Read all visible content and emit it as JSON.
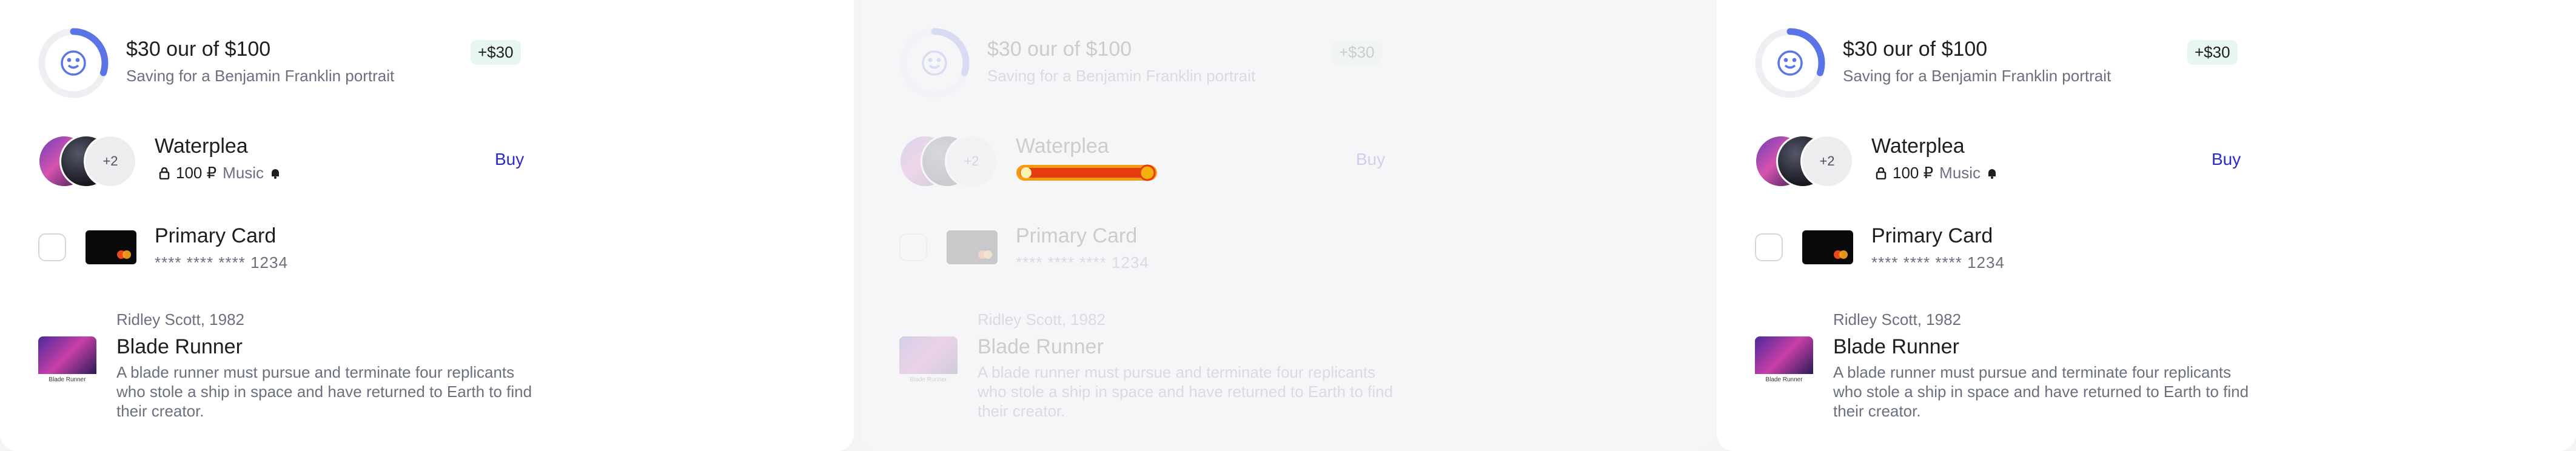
{
  "progress": {
    "title": "$30 our of $100",
    "subtitle": "Saving for a Benjamin Franklin portrait",
    "badge": "+$30",
    "value": 0.3,
    "ring_color": "#5b74e6",
    "icon": "smile-icon"
  },
  "waterplea": {
    "name": "Waterplea",
    "extra_count": "+2",
    "price": "100 ₽",
    "tag": "Music",
    "action": "Buy",
    "action_color": "#2d2ac9"
  },
  "card": {
    "title": "Primary Card",
    "number": "**** **** **** 1234"
  },
  "movie": {
    "author": "Ridley Scott, 1982",
    "title": "Blade Runner",
    "description": "A blade runner must pursue and terminate four replicants who stole a ship in space and have returned to Earth to find their creator.",
    "poster_caption": "Blade Runner"
  }
}
